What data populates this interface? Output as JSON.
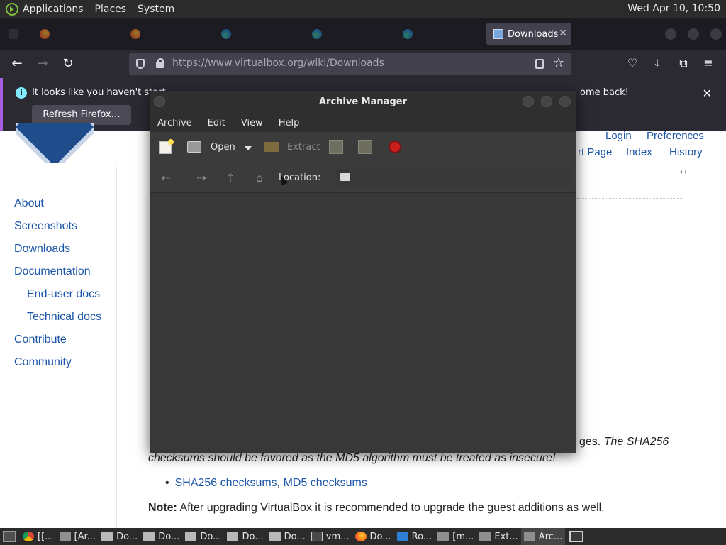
{
  "top_panel": {
    "menus": [
      "Applications",
      "Places",
      "System"
    ],
    "clock": "Wed Apr 10, 10:50"
  },
  "firefox": {
    "active_tab": {
      "title": "Downloads",
      "close": "✕"
    },
    "url": "https://www.virtualbox.org/wiki/Downloads",
    "notification": {
      "message": "It looks like you haven't start",
      "message_tail": "ome back!",
      "button": "Refresh Firefox…"
    }
  },
  "archive_manager": {
    "title": "Archive Manager",
    "menu": [
      "Archive",
      "Edit",
      "View",
      "Help"
    ],
    "toolbar": {
      "open": "Open",
      "extract": "Extract"
    },
    "location_label": "Location:"
  },
  "web_page": {
    "top_links": {
      "login": "Login",
      "preferences": "Preferences",
      "start_page": "rt Page",
      "index": "Index",
      "history": "History"
    },
    "sidebar": [
      "About",
      "Screenshots",
      "Downloads",
      "Documentation",
      "End-user docs",
      "Technical docs",
      "Contribute",
      "Community"
    ],
    "sha_line_a_plain": "ges. ",
    "sha_line_a_italic": "The SHA256",
    "sha_line_b": "checksums should be favored as the MD5 algorithm must be treated as insecure!",
    "checksum_links": {
      "sha256": "SHA256 checksums",
      "separator": ", ",
      "md5": "MD5 checksums"
    },
    "note_label": "Note:",
    "note_text": " After upgrading VirtualBox it is recommended to upgrade the guest additions as well."
  },
  "taskbar": {
    "items": [
      "[[...",
      "[Ar...",
      "Do...",
      "Do...",
      "Do...",
      "Do...",
      "Do...",
      "vm...",
      "Do...",
      "Ro...",
      "[m...",
      "Ext...",
      "Arc..."
    ]
  }
}
